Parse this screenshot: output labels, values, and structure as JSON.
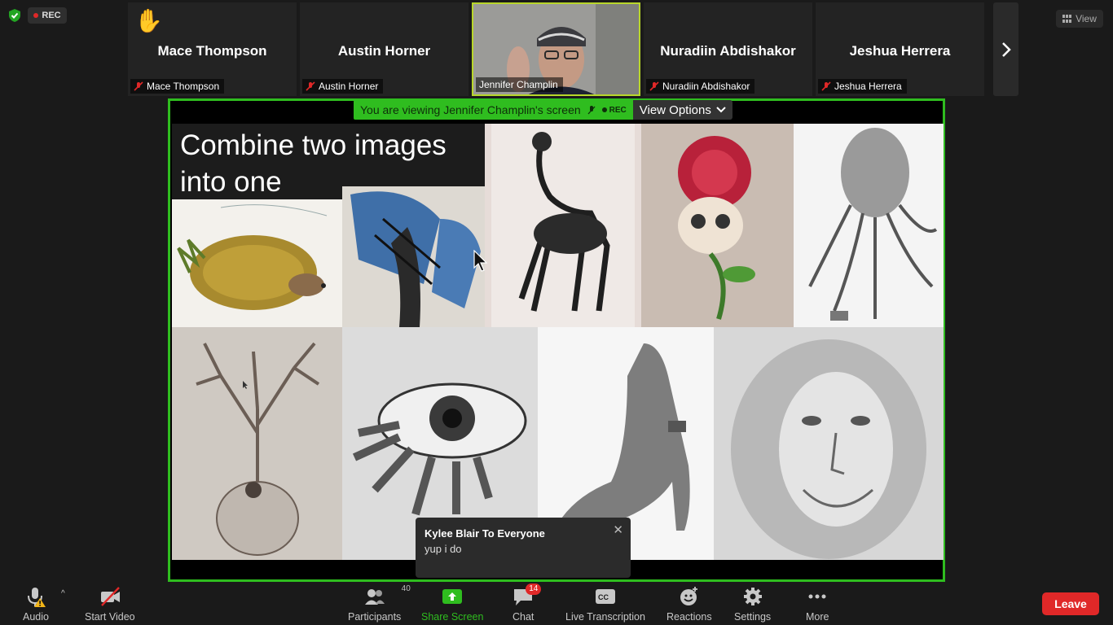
{
  "status": {
    "rec_label": "REC",
    "view_label": "View"
  },
  "participants": [
    {
      "name": "Mace Thompson",
      "label": "Mace Thompson"
    },
    {
      "name": "Austin Horner",
      "label": "Austin Horner"
    },
    {
      "name": "Jennifer Champlin",
      "label": "Jennifer Champlin"
    },
    {
      "name": "Nuradiin Abdishakor",
      "label": "Nuradiin Abdishakor"
    },
    {
      "name": "Jeshua Herrera",
      "label": "Jeshua Herrera"
    }
  ],
  "share": {
    "viewing_text": "You are viewing Jennifer Champlin's screen",
    "rec_label": "REC",
    "view_options_label": "View Options",
    "slide_title": "Combine two images into one"
  },
  "chat_popup": {
    "from": "Kylee Blair To Everyone",
    "message": "yup i do"
  },
  "toolbar": {
    "audio": "Audio",
    "start_video": "Start Video",
    "participants": "Participants",
    "participants_count": "40",
    "share_screen": "Share Screen",
    "chat": "Chat",
    "chat_count": "14",
    "live_transcription": "Live Transcription",
    "cc": "CC",
    "reactions": "Reactions",
    "settings": "Settings",
    "more": "More",
    "leave": "Leave"
  },
  "colors": {
    "accent_green": "#2fbd1f",
    "leave_red": "#e02828",
    "rec_red": "#e02828",
    "hand_yellow": "#f2b518"
  }
}
